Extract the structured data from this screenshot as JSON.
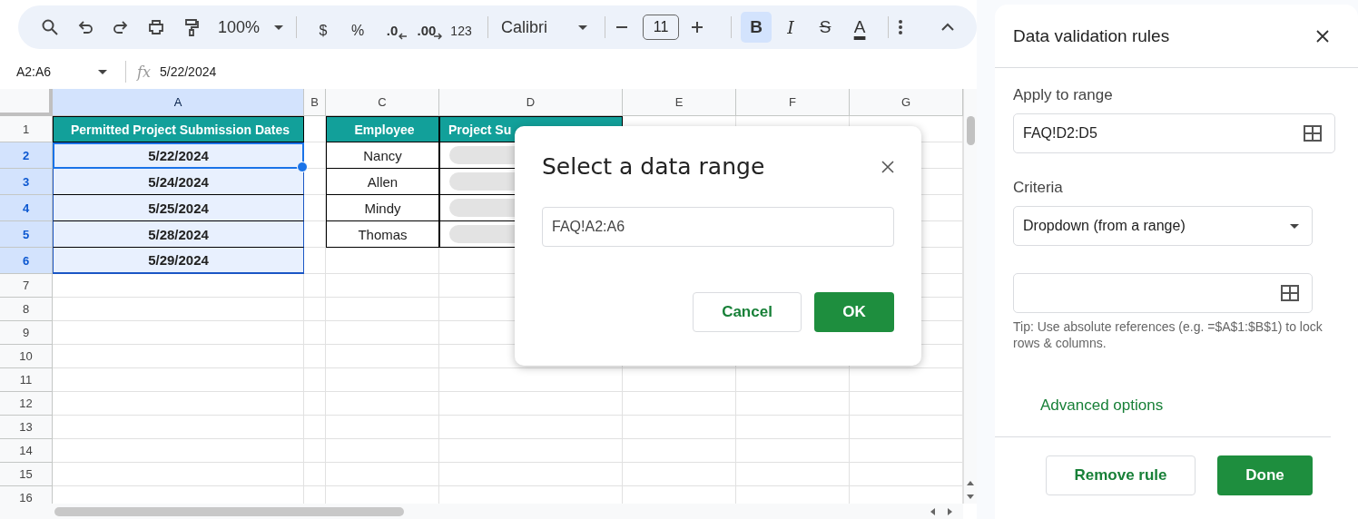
{
  "toolbar": {
    "zoom": "100%",
    "format_buttons": [
      {
        "label": "$",
        "kind": "plain"
      },
      {
        "label": "%",
        "kind": "plain"
      },
      {
        "label": ".0",
        "kind": "decrease"
      },
      {
        "label": ".00",
        "kind": "increase"
      },
      {
        "label": "123",
        "kind": "small"
      }
    ],
    "font": "Calibri",
    "font_size": "11",
    "style_buttons": [
      {
        "label": "B",
        "kind": "bold",
        "selected": true
      },
      {
        "label": "I",
        "kind": "italic",
        "selected": false
      },
      {
        "label": "S",
        "kind": "strike",
        "selected": false
      },
      {
        "label": "A",
        "kind": "color",
        "selected": false
      }
    ]
  },
  "formula_bar": {
    "name_box": "A2:A6",
    "fx": "fx",
    "formula": "5/22/2024"
  },
  "sheet": {
    "columns": [
      {
        "label": "A",
        "selected": true
      },
      {
        "label": "B",
        "selected": false
      },
      {
        "label": "C",
        "selected": false
      },
      {
        "label": "D",
        "selected": false
      },
      {
        "label": "E",
        "selected": false
      },
      {
        "label": "F",
        "selected": false
      },
      {
        "label": "G",
        "selected": false
      }
    ],
    "rows": [
      {
        "label": "1",
        "selected": false,
        "cells": [
          {
            "kind": "header",
            "text": "Permitted Project Submission Dates"
          },
          {
            "kind": "blank"
          },
          {
            "kind": "header",
            "text": "Employee"
          },
          {
            "kind": "header",
            "text": "Project Su"
          },
          {
            "kind": "blank"
          },
          {
            "kind": "blank"
          },
          {
            "kind": "blank"
          }
        ]
      },
      {
        "label": "2",
        "selected": true,
        "cells": [
          {
            "kind": "date",
            "text": "5/22/2024"
          },
          {
            "kind": "blank"
          },
          {
            "kind": "text",
            "text": "Nancy"
          },
          {
            "kind": "dropdown"
          },
          {
            "kind": "blank"
          },
          {
            "kind": "blank"
          },
          {
            "kind": "blank"
          }
        ]
      },
      {
        "label": "3",
        "selected": true,
        "cells": [
          {
            "kind": "date",
            "text": "5/24/2024"
          },
          {
            "kind": "blank"
          },
          {
            "kind": "text",
            "text": "Allen"
          },
          {
            "kind": "dropdown"
          },
          {
            "kind": "blank"
          },
          {
            "kind": "blank"
          },
          {
            "kind": "blank"
          }
        ]
      },
      {
        "label": "4",
        "selected": true,
        "cells": [
          {
            "kind": "date",
            "text": "5/25/2024"
          },
          {
            "kind": "blank"
          },
          {
            "kind": "text",
            "text": "Mindy"
          },
          {
            "kind": "dropdown"
          },
          {
            "kind": "blank"
          },
          {
            "kind": "blank"
          },
          {
            "kind": "blank"
          }
        ]
      },
      {
        "label": "5",
        "selected": true,
        "cells": [
          {
            "kind": "date",
            "text": "5/28/2024"
          },
          {
            "kind": "blank"
          },
          {
            "kind": "text",
            "text": "Thomas"
          },
          {
            "kind": "dropdown"
          },
          {
            "kind": "blank"
          },
          {
            "kind": "blank"
          },
          {
            "kind": "blank"
          }
        ]
      },
      {
        "label": "6",
        "selected": true,
        "cells": [
          {
            "kind": "date",
            "text": "5/29/2024"
          },
          {
            "kind": "blank"
          },
          {
            "kind": "blank"
          },
          {
            "kind": "blank"
          },
          {
            "kind": "blank"
          },
          {
            "kind": "blank"
          },
          {
            "kind": "blank"
          }
        ]
      },
      {
        "label": "7",
        "selected": false
      },
      {
        "label": "8",
        "selected": false
      },
      {
        "label": "9",
        "selected": false
      },
      {
        "label": "10",
        "selected": false
      },
      {
        "label": "11",
        "selected": false
      },
      {
        "label": "12",
        "selected": false
      },
      {
        "label": "13",
        "selected": false
      },
      {
        "label": "14",
        "selected": false
      },
      {
        "label": "15",
        "selected": false
      },
      {
        "label": "16",
        "selected": false
      }
    ]
  },
  "dialog": {
    "title": "Select a data range",
    "value": "FAQ!A2:A6",
    "buttons": [
      {
        "label": "Cancel",
        "kind": "secondary"
      },
      {
        "label": "OK",
        "kind": "primary"
      }
    ]
  },
  "panel": {
    "title": "Data validation rules",
    "range_label": "Apply to range",
    "range_value": "FAQ!D2:D5",
    "criteria_label": "Criteria",
    "criteria_value": "Dropdown (from a range)",
    "tip": "Tip: Use absolute references (e.g. =$A$1:$B$1) to lock rows & columns.",
    "advanced": "Advanced options",
    "buttons": [
      {
        "label": "Remove rule",
        "kind": "secondary"
      },
      {
        "label": "Done",
        "kind": "primary"
      }
    ]
  }
}
